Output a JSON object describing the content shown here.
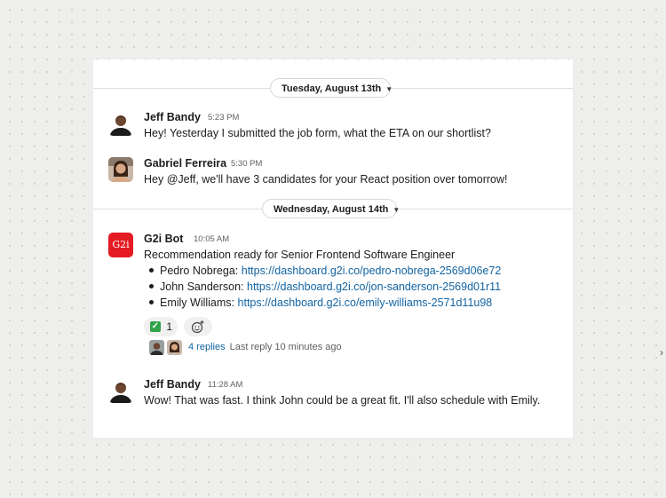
{
  "dates": [
    "Tuesday, August 13th",
    "Wednesday, August 14th"
  ],
  "messages": [
    {
      "author": "Jeff Bandy",
      "time": "5:23 PM",
      "text": "Hey! Yesterday I submitted the job form, what the ETA on our shortlist?"
    },
    {
      "author": "Gabriel Ferreira",
      "time": "5:30 PM",
      "text": "Hey @Jeff, we'll have 3 candidates for your React position over tomorrow!"
    },
    {
      "author": "G2i Bot",
      "avatar_text": "G2i",
      "time": "10:05 AM",
      "text": "Recommendation ready for Senior Frontend Software Engineer",
      "bullets": [
        {
          "label": "Pedro Nobrega:",
          "url": "https://dashboard.g2i.co/pedro-nobrega-2569d06e72"
        },
        {
          "label": "John Sanderson:",
          "url": "https://dashboard.g2i.co/jon-sanderson-2569d01r11"
        },
        {
          "label": "Emily Williams:",
          "url": "https://dashboard.g2i.co/emily-williams-2571d11u98"
        }
      ],
      "reaction": {
        "icon": "white-check-mark-icon",
        "count": "1"
      },
      "thread": {
        "replies": "4 replies",
        "last_reply": "Last reply 10 minutes ago"
      }
    },
    {
      "author": "Jeff Bandy",
      "time": "11:28 AM",
      "text": "Wow! That was fast. I think John could be a great fit. I'll also schedule with Emily."
    }
  ],
  "colors": {
    "link": "#1264a3",
    "bot_avatar": "#e51b23",
    "reaction_check": "#31a24c"
  }
}
